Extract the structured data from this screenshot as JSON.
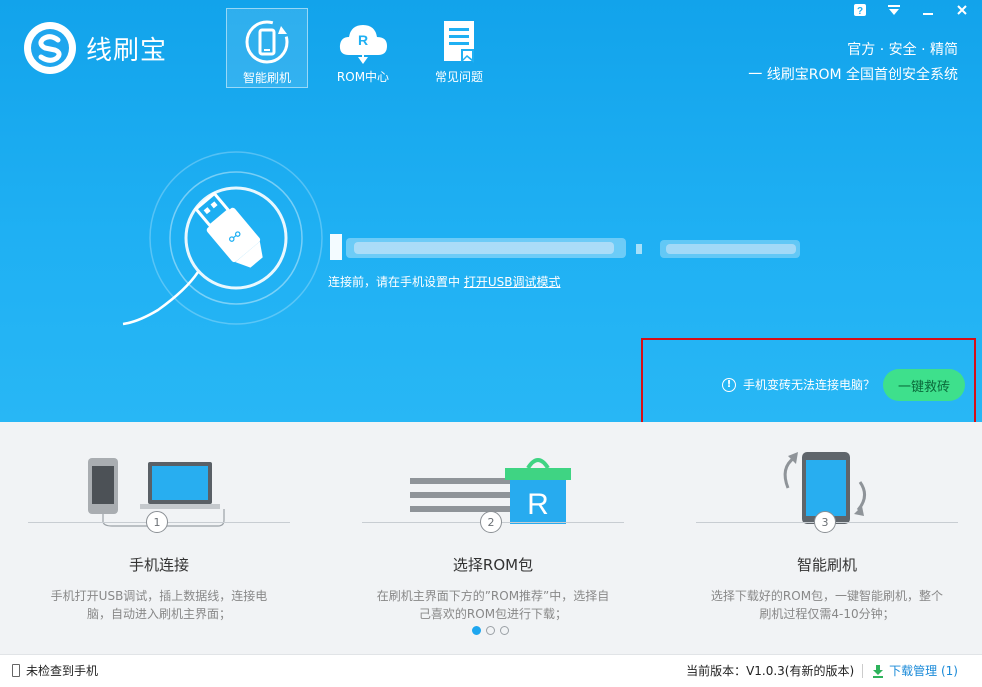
{
  "app": {
    "name": "线刷宝"
  },
  "nav": [
    {
      "label": "智能刷机",
      "icon": "phone-refresh-icon",
      "active": true
    },
    {
      "label": "ROM中心",
      "icon": "cloud-rom-icon",
      "active": false
    },
    {
      "label": "常见问题",
      "icon": "document-icon",
      "active": false
    }
  ],
  "tagline": {
    "line1": "官方 · 安全 · 精简",
    "line2": "一 线刷宝ROM 全国首创安全系统"
  },
  "main": {
    "hint_prefix": "连接前，请在手机设置中",
    "hint_link": "打开USB调试模式"
  },
  "rescue": {
    "question": "手机变砖无法连接电脑？",
    "button": "一键救砖"
  },
  "steps": [
    {
      "num": "1",
      "title": "手机连接",
      "desc": "手机打开USB调试，插上数据线，连接电脑，自动进入刷机主界面；"
    },
    {
      "num": "2",
      "title": "选择ROM包",
      "desc": "在刷机主界面下方的”ROM推荐”中，选择自己喜欢的ROM包进行下载；"
    },
    {
      "num": "3",
      "title": "智能刷机",
      "desc": "选择下载好的ROM包，一键智能刷机，整个刷机过程仅需4-10分钟；"
    }
  ],
  "pager": {
    "count": 3,
    "active": 1
  },
  "status": {
    "device": "未检查到手机",
    "version": "当前版本：V1.0.3(有新的版本)",
    "downloads": "下载管理 (1)"
  },
  "colors": {
    "primary": "#1fb0f3",
    "rescue_button": "#3ee08c",
    "highlight_box": "#d60e16"
  }
}
